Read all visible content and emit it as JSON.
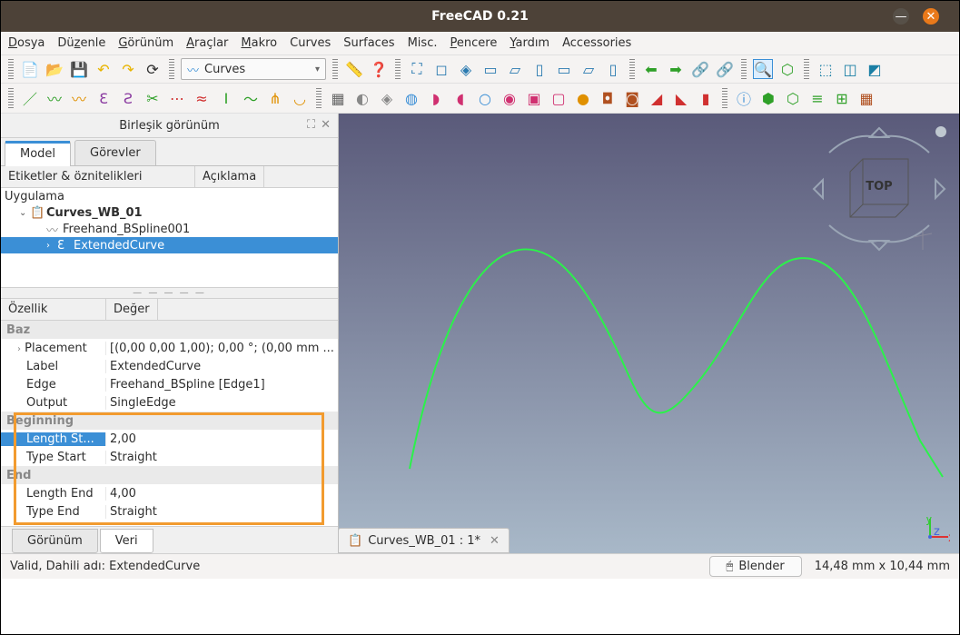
{
  "title": "FreeCAD 0.21",
  "menu": {
    "file": "Dosya",
    "edit": "Düzenle",
    "view": "Görünüm",
    "tools": "Araçlar",
    "macro": "Makro",
    "curves": "Curves",
    "surfaces": "Surfaces",
    "misc": "Misc.",
    "windows": "Pencere",
    "help": "Yardım",
    "accessories": "Accessories"
  },
  "workbench": "Curves",
  "panel_title": "Birleşik görünüm",
  "tabs": {
    "model": "Model",
    "tasks": "Görevler"
  },
  "tree_hdr": {
    "labels": "Etiketler & öznitelikleri",
    "desc": "Açıklama"
  },
  "tree": {
    "app": "Uygulama",
    "doc": "Curves_WB_01",
    "item1": "Freehand_BSpline001",
    "item2": "ExtendedCurve"
  },
  "prop_hdr": {
    "prop": "Özellik",
    "val": "Değer"
  },
  "props": {
    "grp_baz": "Baz",
    "placement_l": "Placement",
    "placement_v": "[(0,00 0,00 1,00); 0,00 °; (0,00 mm ...",
    "label_l": "Label",
    "label_v": "ExtendedCurve",
    "edge_l": "Edge",
    "edge_v": "Freehand_BSpline [Edge1]",
    "output_l": "Output",
    "output_v": "SingleEdge",
    "grp_beg": "Beginning",
    "ls_l": "Length St...",
    "ls_v": "2,00",
    "ts_l": "Type Start",
    "ts_v": "Straight",
    "grp_end": "End",
    "le_l": "Length End",
    "le_v": "4,00",
    "te_l": "Type End",
    "te_v": "Straight"
  },
  "btabs": {
    "view": "Görünüm",
    "data": "Veri"
  },
  "navcube": "TOP",
  "doctab": "Curves_WB_01 : 1*",
  "status": {
    "msg": "Valid, Dahili adı: ExtendedCurve",
    "nav": "Blender",
    "dims": "14,48 mm x 10,44 mm"
  },
  "chart_data": {
    "type": "line",
    "title": "ExtendedCurve (green bspline) — Top view",
    "series": [
      {
        "name": "ExtendedCurve",
        "color": "#2bf24a",
        "x": [
          0,
          0.08,
          0.16,
          0.24,
          0.32,
          0.4,
          0.48,
          0.56,
          0.64,
          0.72,
          0.8,
          0.88,
          0.96,
          1.0
        ],
        "y": [
          0.05,
          0.35,
          0.7,
          0.9,
          0.7,
          0.35,
          0.12,
          0.35,
          0.7,
          0.88,
          0.7,
          0.35,
          0.05,
          0.0
        ]
      }
    ],
    "xlabel": "",
    "ylabel": "",
    "xlim": [
      0,
      1
    ],
    "ylim": [
      0,
      1
    ]
  }
}
